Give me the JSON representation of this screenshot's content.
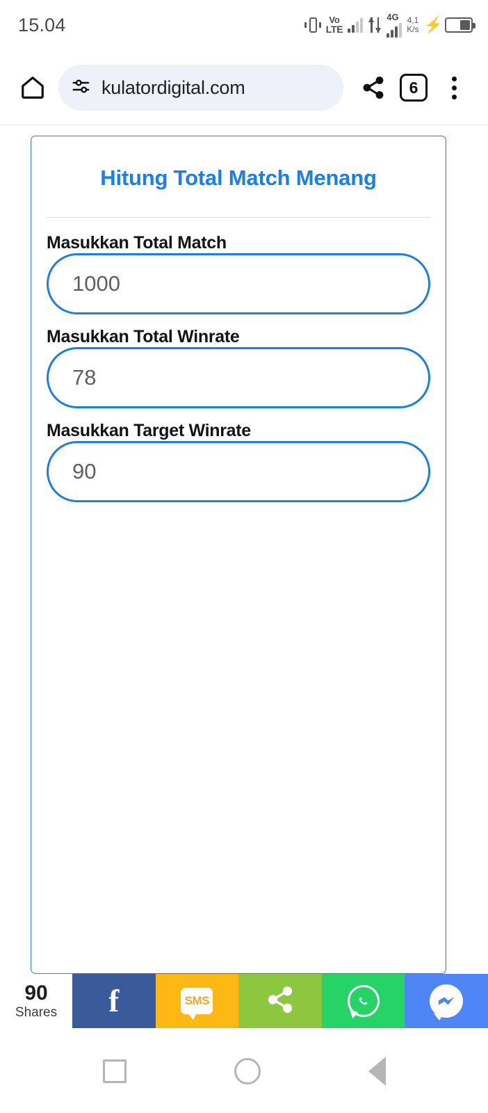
{
  "status_bar": {
    "clock": "15.04",
    "vibrate_icon": "vibrate-icon",
    "volte_line1": "Vo",
    "volte_line2": "LTE",
    "network_label": "4G",
    "data_speed_value": "4,1",
    "data_speed_unit": "K/s",
    "charging_icon": "charging-bolt-icon",
    "battery_icon": "battery-icon"
  },
  "browser": {
    "home_icon": "home-icon",
    "page_info_icon": "tune-icon",
    "url": "kulatordigital.com",
    "share_icon": "share-icon",
    "tab_count": "6",
    "menu_icon": "overflow-menu-icon"
  },
  "card": {
    "title": "Hitung Total Match Menang",
    "accent_color": "#1a7fe8",
    "border_color": "#2a7fd4",
    "fields": [
      {
        "label": "Masukkan Total Match",
        "placeholder": "1000",
        "value": ""
      },
      {
        "label": "Masukkan Total Winrate",
        "placeholder": "78",
        "value": ""
      },
      {
        "label": "Masukkan Target Winrate",
        "placeholder": "90",
        "value": ""
      }
    ]
  },
  "share_bar": {
    "count": "90",
    "count_label": "Shares",
    "tiles": [
      {
        "name": "facebook",
        "glyph": "f",
        "color": "#3b5a9b"
      },
      {
        "name": "sms",
        "glyph": "SMS",
        "color": "#fdb813"
      },
      {
        "name": "share",
        "glyph": "",
        "color": "#8dc63f"
      },
      {
        "name": "whatsapp",
        "glyph": "",
        "color": "#25d366"
      },
      {
        "name": "messenger",
        "glyph": "",
        "color": "#4e86f7"
      }
    ]
  },
  "android_nav": {
    "recents": "recents-square-icon",
    "home": "home-circle-icon",
    "back": "back-triangle-icon"
  }
}
